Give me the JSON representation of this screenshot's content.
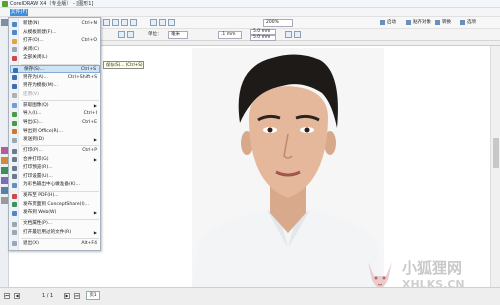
{
  "window": {
    "title": "CorelDRAW X4（专业版） - [图形1]"
  },
  "menubar": {
    "file_label": "文件(F)"
  },
  "toolbar": {
    "zoom_value": "200%",
    "btn_launch": "启动",
    "btn_snap": "贴齐对象",
    "btn_convert": "转换",
    "btn_options": "选项"
  },
  "property_bar": {
    "units_label": "单位：",
    "units_value": "毫米",
    "nudge_value": ".1 mm",
    "dup_x": "5.0 mm",
    "dup_y": "5.0 mm"
  },
  "file_menu": {
    "items": [
      {
        "label": "新建(N)",
        "shortcut": "Ctrl+N",
        "icon_color": "#4f86c6",
        "disabled": false
      },
      {
        "label": "从模板新建(F)...",
        "shortcut": "",
        "icon_color": "#4f86c6",
        "disabled": false
      },
      {
        "label": "打开(O)...",
        "shortcut": "Ctrl+O",
        "icon_color": "#e0a83a",
        "disabled": false
      },
      {
        "label": "关闭(C)",
        "shortcut": "",
        "icon_color": "#9aa7b5",
        "disabled": false
      },
      {
        "label": "全部关闭(L)",
        "shortcut": "",
        "icon_color": "#c94a4a",
        "disabled": false
      },
      {
        "label": "保存(S)...",
        "shortcut": "Ctrl+S",
        "icon_color": "#3c6fb0",
        "disabled": false,
        "highlight": true
      },
      {
        "label": "另存为(A)...",
        "shortcut": "Ctrl+Shift+S",
        "icon_color": "#3c6fb0",
        "disabled": false
      },
      {
        "label": "另存为模板(M)...",
        "shortcut": "",
        "icon_color": "#3c6fb0",
        "disabled": false
      },
      {
        "label": "还原(V)",
        "shortcut": "",
        "icon_color": "#b0b0b0",
        "disabled": true
      },
      {
        "label": "获取图像(Q)",
        "shortcut": "",
        "icon_color": "#6f9fd0",
        "disabled": false,
        "submenu": true
      },
      {
        "label": "导入(I)...",
        "shortcut": "Ctrl+I",
        "icon_color": "#4a9a4a",
        "disabled": false
      },
      {
        "label": "导出(E)...",
        "shortcut": "Ctrl+E",
        "icon_color": "#4a9a4a",
        "disabled": false
      },
      {
        "label": "导出到 Office(R)...",
        "shortcut": "",
        "icon_color": "#d3772f",
        "disabled": false
      },
      {
        "label": "发送到(D)",
        "shortcut": "",
        "icon_color": "#9aa7b5",
        "disabled": false,
        "submenu": true
      },
      {
        "label": "打印(P)...",
        "shortcut": "Ctrl+P",
        "icon_color": "#6b7b8c",
        "disabled": false
      },
      {
        "label": "合并打印(G)",
        "shortcut": "",
        "icon_color": "#6b7b8c",
        "disabled": false,
        "submenu": true
      },
      {
        "label": "打印预览(R)...",
        "shortcut": "",
        "icon_color": "#6b7b8c",
        "disabled": false
      },
      {
        "label": "打印设置(U)...",
        "shortcut": "",
        "icon_color": "#6b7b8c",
        "disabled": false
      },
      {
        "label": "为彩色输出中心做准备(K)...",
        "shortcut": "",
        "icon_color": "#5f8fc0",
        "disabled": false
      },
      {
        "label": "发布至 PDF(H)...",
        "shortcut": "",
        "icon_color": "#c94a4a",
        "disabled": false
      },
      {
        "label": "发布页面到 ConceptShare(I)...",
        "shortcut": "",
        "icon_color": "#3f8f5f",
        "disabled": false
      },
      {
        "label": "发布到 Web(W)",
        "shortcut": "",
        "icon_color": "#4f86c6",
        "disabled": false,
        "submenu": true
      },
      {
        "label": "文档属性(P)...",
        "shortcut": "",
        "icon_color": "#9aa7b5",
        "disabled": false
      },
      {
        "label": "打开最近用过的文件(R)",
        "shortcut": "",
        "icon_color": "#9aa7b5",
        "disabled": false,
        "submenu": true
      },
      {
        "label": "退出(X)",
        "shortcut": "Alt+F4",
        "icon_color": "#9aa7b5",
        "disabled": false
      }
    ]
  },
  "tooltip": {
    "text": "保存(S)... (Ctrl+S)"
  },
  "statusbar": {
    "page_count": "1 / 1",
    "page_tab": "页1"
  },
  "watermark": {
    "name": "小狐狸网",
    "url": "XHLKS.CN"
  },
  "photo": {
    "alt": "portrait-photo"
  }
}
